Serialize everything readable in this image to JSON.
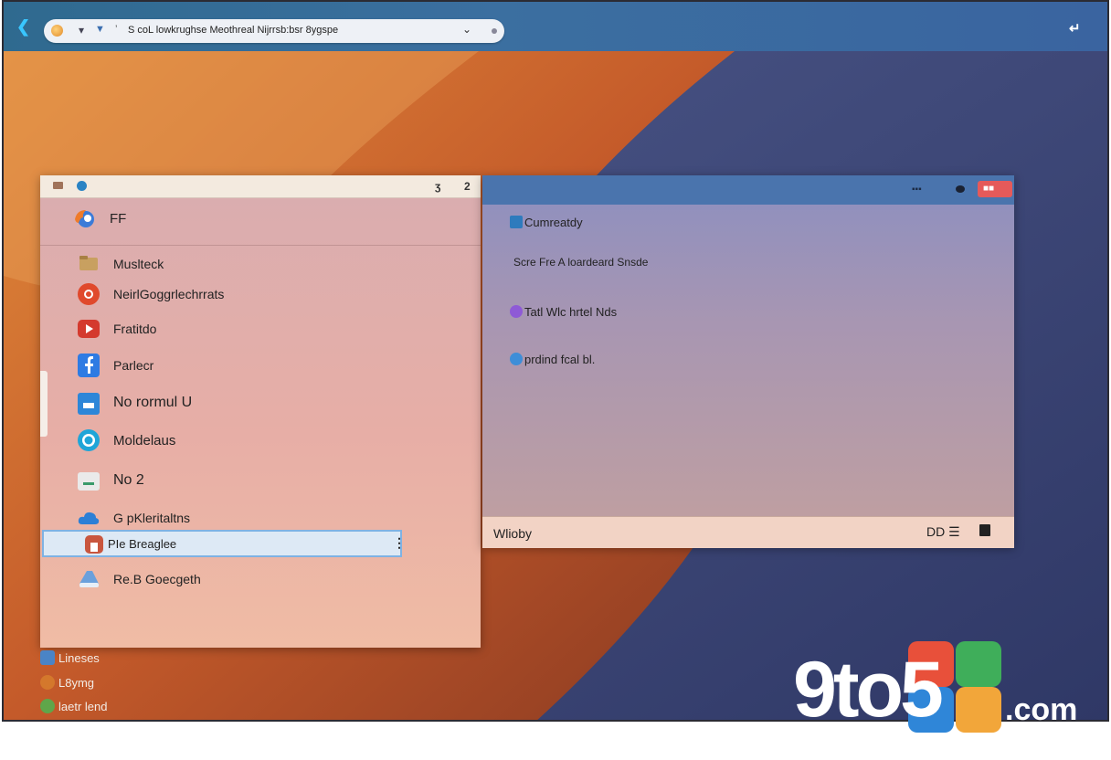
{
  "browser": {
    "url_text": "S coL lowkrughse Meothreal Nijrrsb:bsr 8ygspe"
  },
  "left_panel": {
    "header_label": "FF",
    "items": [
      {
        "label": "Muslteck",
        "icon": "folder-icon",
        "color": "#c8a060"
      },
      {
        "label": "NeirlGoggrlechrrats",
        "icon": "chrome-icon",
        "color": "#e0492c"
      },
      {
        "label": "Fratitdo",
        "icon": "youtube-icon",
        "color": "#d43a2e"
      },
      {
        "label": "Parlecr",
        "icon": "facebook-icon",
        "color": "#2e7be3"
      },
      {
        "label": "No rormul U",
        "icon": "window-icon",
        "color": "#2d86d8"
      },
      {
        "label": "Moldelaus",
        "icon": "ring-icon",
        "color": "#1fa5d8"
      },
      {
        "label": "No 2",
        "icon": "image-icon",
        "color": "#eaeaea"
      },
      {
        "label": "G pKleritaltns",
        "icon": "cloud-icon",
        "color": "#2c7fd6"
      },
      {
        "label": "PIe Breaglee",
        "icon": "app-icon",
        "color": "#c9563e",
        "selected": true
      },
      {
        "label": "Re.B Goecgeth",
        "icon": "drive-icon",
        "color": "#6aa0dc"
      }
    ]
  },
  "right_panel": {
    "rows": [
      {
        "label": "Cumreatdy",
        "icon": "document-icon",
        "color": "#2e7bbd"
      },
      {
        "label": "Scre Fre A loardeard Snsde",
        "icon": "",
        "color": ""
      },
      {
        "label": "Tatl Wlc hrtel Nds",
        "icon": "video-icon",
        "color": "#8e5ad6"
      },
      {
        "label": "prdind fcal bl.",
        "icon": "globe-icon",
        "color": "#3e8ed8"
      }
    ],
    "footer_label": "Wlioby",
    "footer_right": "DD"
  },
  "desktop": {
    "items": [
      {
        "label": "Lineses",
        "icon": "file-icon",
        "color": "#4a84c6"
      },
      {
        "label": "L8ymg",
        "icon": "app-icon",
        "color": "#d4782c"
      },
      {
        "label": "laetr lend",
        "icon": "browser-icon",
        "color": "#5fa64a"
      }
    ]
  },
  "logo": {
    "text": "9to5",
    "suffix": ".com"
  },
  "colors": {
    "topbar": "#3b6fa0",
    "wallpaper_orange": "#c8622a",
    "wallpaper_indigo": "#3f4a78",
    "selection_border": "#7fb2e3",
    "close_button": "#e55a5a"
  }
}
